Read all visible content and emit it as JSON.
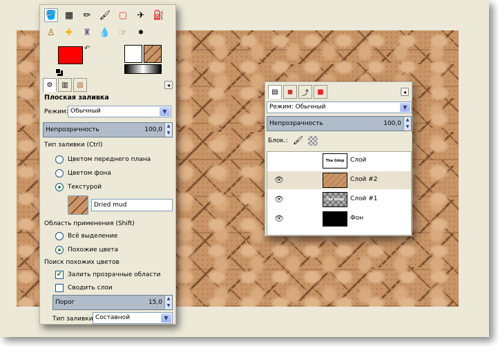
{
  "toolbox": {
    "tool_options_title": "Плоская заливка",
    "mode_label": "Режим:",
    "mode_value": "Обычный",
    "opacity_label": "Непрозрачность",
    "opacity_value": "100,0",
    "fill_type_label": "Тип заливки (Ctrl)",
    "fill_options": [
      "Цветом переднего плана",
      "Цветом фона",
      "Текстурой"
    ],
    "pattern_name": "Dried mud",
    "affected_area_label": "Область применения (Shift)",
    "area_options": [
      "Всё выделение",
      "Похожие цвета"
    ],
    "find_similar_label": "Поиск похожих цветов",
    "fill_transparent": "Залить прозрачные области",
    "sample_merged": "Сводить слои",
    "threshold_label": "Порог",
    "threshold_value": "15,0",
    "fill_by_label": "Тип заливки:",
    "fill_by_value": "Составной",
    "fg_color": "#ff0000",
    "bg_color": "#ffffff"
  },
  "layers": {
    "mode_label": "Режим:",
    "mode_value": "Обычный",
    "opacity_label": "Непрозрачность",
    "opacity_value": "100,0",
    "lock_label": "Блок.:",
    "items": [
      {
        "name": "Слой",
        "thumb": "The Gimp",
        "visible": false
      },
      {
        "name": "Слой #2",
        "thumb": "",
        "visible": true
      },
      {
        "name": "Слой #1",
        "thumb": "The Gimp",
        "visible": true
      },
      {
        "name": "Фон",
        "thumb": "",
        "visible": true
      }
    ]
  }
}
